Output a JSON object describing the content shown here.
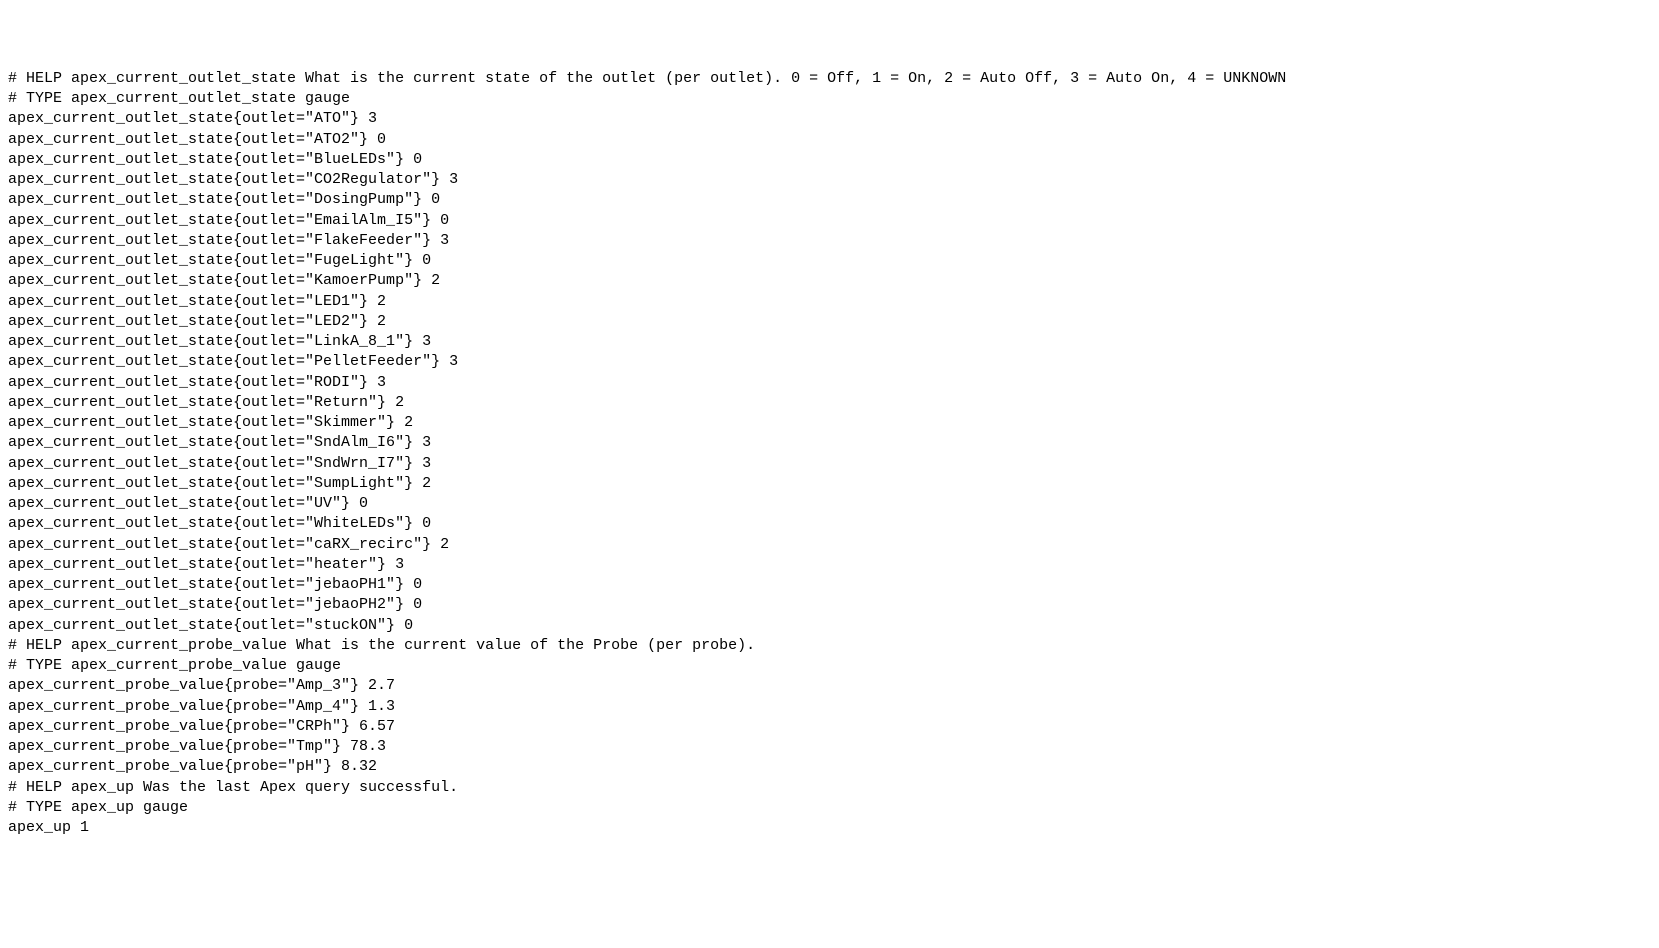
{
  "metrics": {
    "outlet_state": {
      "help": "# HELP apex_current_outlet_state What is the current state of the outlet (per outlet). 0 = Off, 1 = On, 2 = Auto Off, 3 = Auto On, 4 = UNKNOWN",
      "type": "# TYPE apex_current_outlet_state gauge",
      "name": "apex_current_outlet_state",
      "label_key": "outlet",
      "entries": [
        {
          "label": "ATO",
          "value": "3"
        },
        {
          "label": "ATO2",
          "value": "0"
        },
        {
          "label": "BlueLEDs",
          "value": "0"
        },
        {
          "label": "CO2Regulator",
          "value": "3"
        },
        {
          "label": "DosingPump",
          "value": "0"
        },
        {
          "label": "EmailAlm_I5",
          "value": "0"
        },
        {
          "label": "FlakeFeeder",
          "value": "3"
        },
        {
          "label": "FugeLight",
          "value": "0"
        },
        {
          "label": "KamoerPump",
          "value": "2"
        },
        {
          "label": "LED1",
          "value": "2"
        },
        {
          "label": "LED2",
          "value": "2"
        },
        {
          "label": "LinkA_8_1",
          "value": "3"
        },
        {
          "label": "PelletFeeder",
          "value": "3"
        },
        {
          "label": "RODI",
          "value": "3"
        },
        {
          "label": "Return",
          "value": "2"
        },
        {
          "label": "Skimmer",
          "value": "2"
        },
        {
          "label": "SndAlm_I6",
          "value": "3"
        },
        {
          "label": "SndWrn_I7",
          "value": "3"
        },
        {
          "label": "SumpLight",
          "value": "2"
        },
        {
          "label": "UV",
          "value": "0"
        },
        {
          "label": "WhiteLEDs",
          "value": "0"
        },
        {
          "label": "caRX_recirc",
          "value": "2"
        },
        {
          "label": "heater",
          "value": "3"
        },
        {
          "label": "jebaoPH1",
          "value": "0"
        },
        {
          "label": "jebaoPH2",
          "value": "0"
        },
        {
          "label": "stuckON",
          "value": "0"
        }
      ]
    },
    "probe_value": {
      "help": "# HELP apex_current_probe_value What is the current value of the Probe (per probe).",
      "type": "# TYPE apex_current_probe_value gauge",
      "name": "apex_current_probe_value",
      "label_key": "probe",
      "entries": [
        {
          "label": "Amp_3",
          "value": "2.7"
        },
        {
          "label": "Amp_4",
          "value": "1.3"
        },
        {
          "label": "CRPh",
          "value": "6.57"
        },
        {
          "label": "Tmp",
          "value": "78.3"
        },
        {
          "label": "pH",
          "value": "8.32"
        }
      ]
    },
    "apex_up": {
      "help": "# HELP apex_up Was the last Apex query successful.",
      "type": "# TYPE apex_up gauge",
      "line": "apex_up 1"
    }
  }
}
